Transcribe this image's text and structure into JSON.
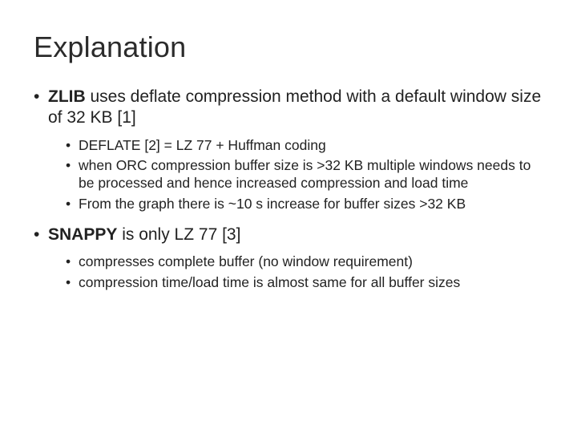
{
  "title": "Explanation",
  "bullets": [
    {
      "parts": [
        {
          "strong": "ZLIB",
          "rest": " uses deflate compression method with a default window size of 32 KB [1]"
        }
      ],
      "sub": [
        "DEFLATE [2] = LZ 77 + Huffman coding",
        "when ORC compression buffer size is >32 KB multiple windows needs to be processed and hence increased compression and load time",
        "From the graph there is ~10 s increase for buffer sizes >32 KB"
      ]
    },
    {
      "parts": [
        {
          "strong": "SNAPPY",
          "rest": " is only LZ 77 [3]"
        }
      ],
      "sub": [
        "compresses complete buffer (no window requirement)",
        "compression time/load time is almost same for all buffer sizes"
      ]
    }
  ]
}
